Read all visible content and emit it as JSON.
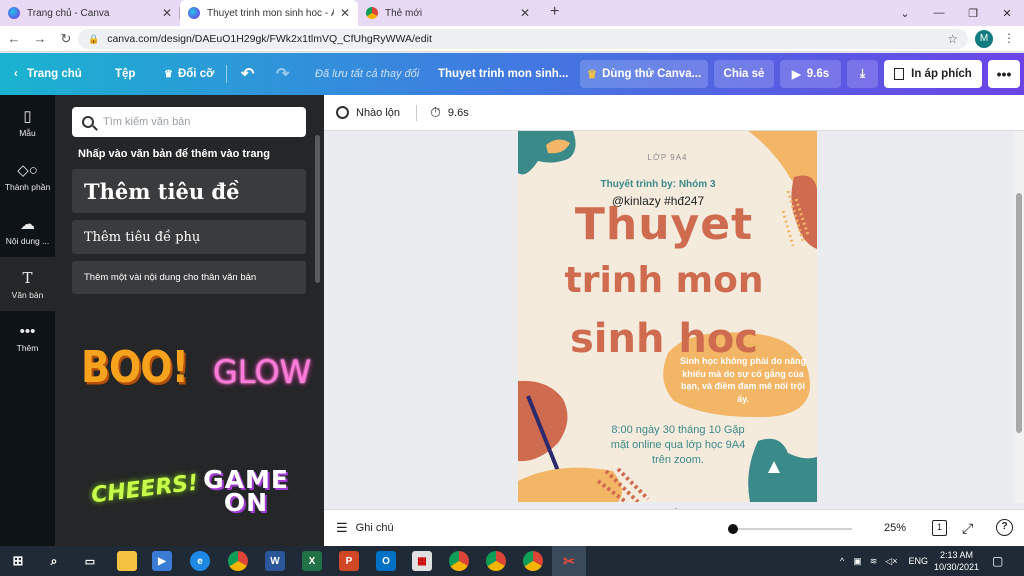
{
  "browser": {
    "tabs": [
      {
        "title": "Trang chủ - Canva",
        "icon": "canva-icon"
      },
      {
        "title": "Thuyet trinh mon sinh hoc - Áp p",
        "icon": "canva-icon"
      },
      {
        "title": "Thẻ mới",
        "icon": "chrome-icon"
      }
    ],
    "url": "canva.com/design/DAEuO1H29gk/FWk2x1tlmVQ_CfUhgRyWWA/edit",
    "profile_initial": "M"
  },
  "topbar": {
    "home": "Trang chủ",
    "file": "Tệp",
    "resize": "Đổi cỡ",
    "saved_status": "Đã lưu tất cả thay đổi",
    "design_title": "Thuyet trinh mon sinh...",
    "try_canva": "Dùng thử Canva...",
    "share": "Chia sẻ",
    "play_duration": "9.6s",
    "print": "In áp phích"
  },
  "rail": [
    {
      "label": "Mẫu",
      "icon": "layout-icon"
    },
    {
      "label": "Thành phần",
      "icon": "shapes-icon"
    },
    {
      "label": "Nội dung ...",
      "icon": "upload-icon"
    },
    {
      "label": "Văn bản",
      "icon": "text-icon"
    },
    {
      "label": "Thêm",
      "icon": "more-icon"
    }
  ],
  "panel": {
    "search_placeholder": "Tìm kiếm văn bản",
    "hint": "Nhấp vào văn bản để thêm vào trang",
    "add_heading": "Thêm tiêu đề",
    "add_subheading": "Thêm tiêu đề phụ",
    "add_body": "Thêm một vài nội dung cho thân văn bản",
    "stickers": [
      "BOO!",
      "GLOW",
      "CHEERS!",
      "GAME ON"
    ]
  },
  "context_bar": {
    "shuffle": "Nhào lộn",
    "timing": "9.6s"
  },
  "poster": {
    "class": "LỚP 9A4",
    "presenter": "Thuyết trình by: Nhóm 3",
    "handle": "@kinlazy #hđ247",
    "title_lines": [
      "Thuyet",
      "trinh mon",
      "sinh hoc"
    ],
    "quote": "Sinh học không phải do năng khiếu mà do sự cố gắng của bạn, và điềm đam mê nối trội ấy.",
    "schedule": "8:00 ngày 30 tháng 10 Gặp mặt online qua lớp học 9A4 trên zoom.",
    "colors": {
      "background": "#f5ebdd",
      "title": "#cf6b4f",
      "teal": "#3b8a8a",
      "accent": "#f2b666"
    }
  },
  "bottom_bar": {
    "notes": "Ghi chú",
    "zoom": "25%",
    "zoom_level": 0.0,
    "page_number": "1"
  },
  "taskbar": {
    "language": "ENG",
    "time": "2:13 AM",
    "date": "10/30/2021"
  }
}
